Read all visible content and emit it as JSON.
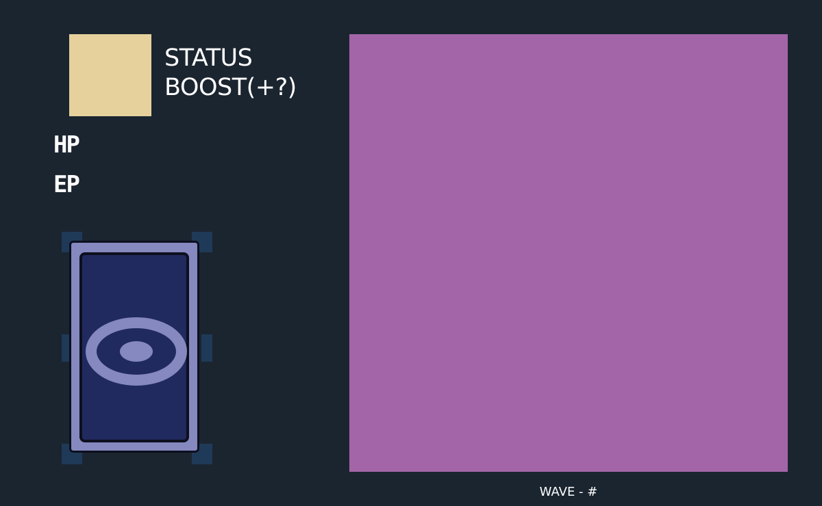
{
  "item": {
    "name_line1": "STATUS",
    "name_line2": "BOOST(+?)",
    "swatch_color": "#e6d19d"
  },
  "stats": {
    "hp_label": "HP",
    "ep_label": "EP"
  },
  "card": {
    "state": "face-down",
    "emblem": "eye-icon",
    "frame_color": "#8589bf",
    "face_color": "#212a5e",
    "slot_marker_color": "#1f3a58"
  },
  "preview": {
    "color": "#a365a8"
  },
  "wave": {
    "label": "WAVE - #"
  },
  "theme": {
    "background": "#1b2530",
    "text": "#ffffff"
  }
}
